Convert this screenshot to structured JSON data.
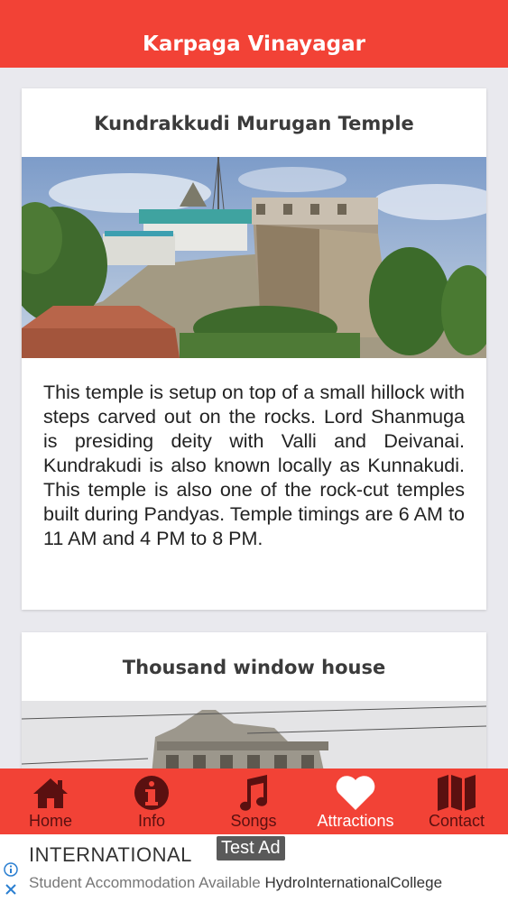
{
  "app": {
    "title": "Karpaga Vinayagar"
  },
  "cards": [
    {
      "title": "Kundrakkudi Murugan Temple",
      "image": "hilltop-temple-photo",
      "text": "This temple is setup on top of a small hillock with steps carved out on the rocks. Lord Shanmuga is presiding deity with Valli and Deivanai. Kundrakudi is also known locally as Kunnakudi. This temple is also one of the rock-cut temples built during Pandyas. Temple timings are 6 AM to 11 AM and 4 PM to 8 PM."
    },
    {
      "title": "Thousand window house",
      "image": "heritage-house-photo"
    }
  ],
  "tabs": [
    {
      "label": "Home",
      "icon": "home-icon",
      "active": false
    },
    {
      "label": "Info",
      "icon": "info-icon",
      "active": false
    },
    {
      "label": "Songs",
      "icon": "music-note-icon",
      "active": false
    },
    {
      "label": "Attractions",
      "icon": "heart-icon",
      "active": true
    },
    {
      "label": "Contact",
      "icon": "map-icon",
      "active": false
    }
  ],
  "ad": {
    "tag": "Test Ad",
    "brand": "INTERNATIONAL",
    "subtitle": "Student Accommodation Available",
    "advertiser": "HydroInternationalCollege"
  },
  "colors": {
    "primary": "#f24236",
    "tab_inactive": "#5a1010",
    "tab_active": "#ffffff"
  }
}
